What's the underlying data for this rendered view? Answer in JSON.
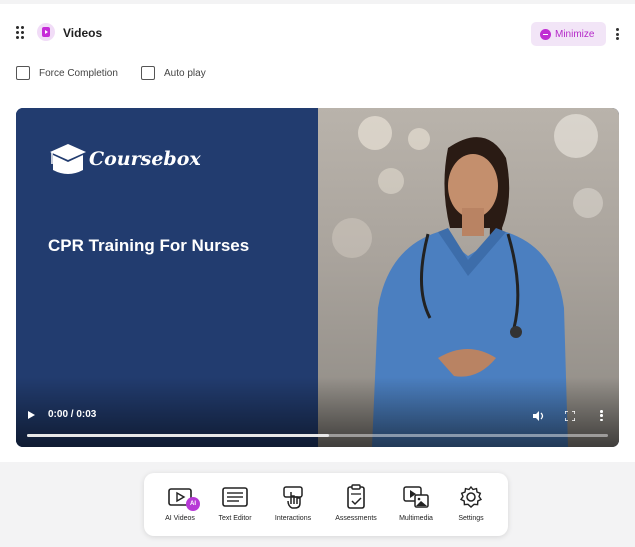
{
  "header": {
    "section_title": "Videos",
    "minimize_label": "Minimize"
  },
  "options": [
    {
      "label": "Force Completion",
      "checked": false
    },
    {
      "label": "Auto play",
      "checked": false
    }
  ],
  "video": {
    "brand_name": "Coursebox",
    "slide_title": "CPR Training For Nurses",
    "time_display": "0:00 / 0:03",
    "progress_fraction": 0.52
  },
  "toolbar": {
    "items": [
      {
        "label": "AI Videos",
        "icon": "ai-video-icon",
        "badge": "AI"
      },
      {
        "label": "Text Editor",
        "icon": "text-editor-icon"
      },
      {
        "label": "Interactions",
        "icon": "pointer-hand-icon"
      },
      {
        "label": "Assessments",
        "icon": "clipboard-check-icon"
      },
      {
        "label": "Multimedia",
        "icon": "multimedia-icon"
      },
      {
        "label": "Settings",
        "icon": "gear-icon"
      }
    ]
  },
  "colors": {
    "accent": "#c02ed3",
    "accent_soft": "#f2e5f7",
    "slide_background": "#223c6f",
    "page_background": "#f3f3f4"
  }
}
